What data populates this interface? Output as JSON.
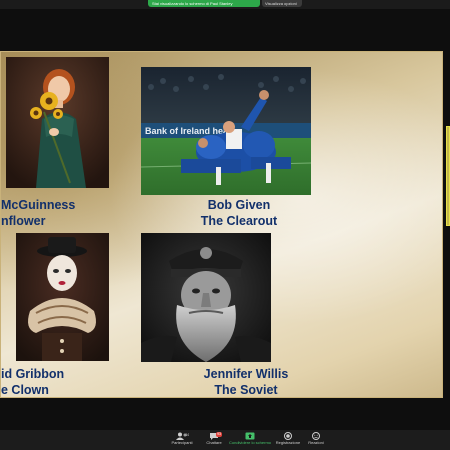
{
  "top": {
    "share_banner": "Stai visualizzando lo schermo di Paul Stanley",
    "view_options": "Visualizza opzioni"
  },
  "slide": {
    "entries": [
      {
        "author": "McGuinness",
        "title": "nflower"
      },
      {
        "author": "Bob Given",
        "title": "The Clearout"
      },
      {
        "author": "id Gribbon",
        "title": "e Clown"
      },
      {
        "author": "Jennifer Willis",
        "title": "The Soviet"
      }
    ],
    "stadium_ad": "Bank of Ireland   heal"
  },
  "toolbar": {
    "participants_label": "Partecipanti",
    "participants_count": "161",
    "chat_label": "Chattare",
    "chat_badge": "93",
    "share_label": "Condividere lo schermo",
    "record_label": "Registrazione",
    "reactions_label": "Reazioni"
  },
  "colors": {
    "caption": "#12306b",
    "share_green": "#2da84a"
  }
}
